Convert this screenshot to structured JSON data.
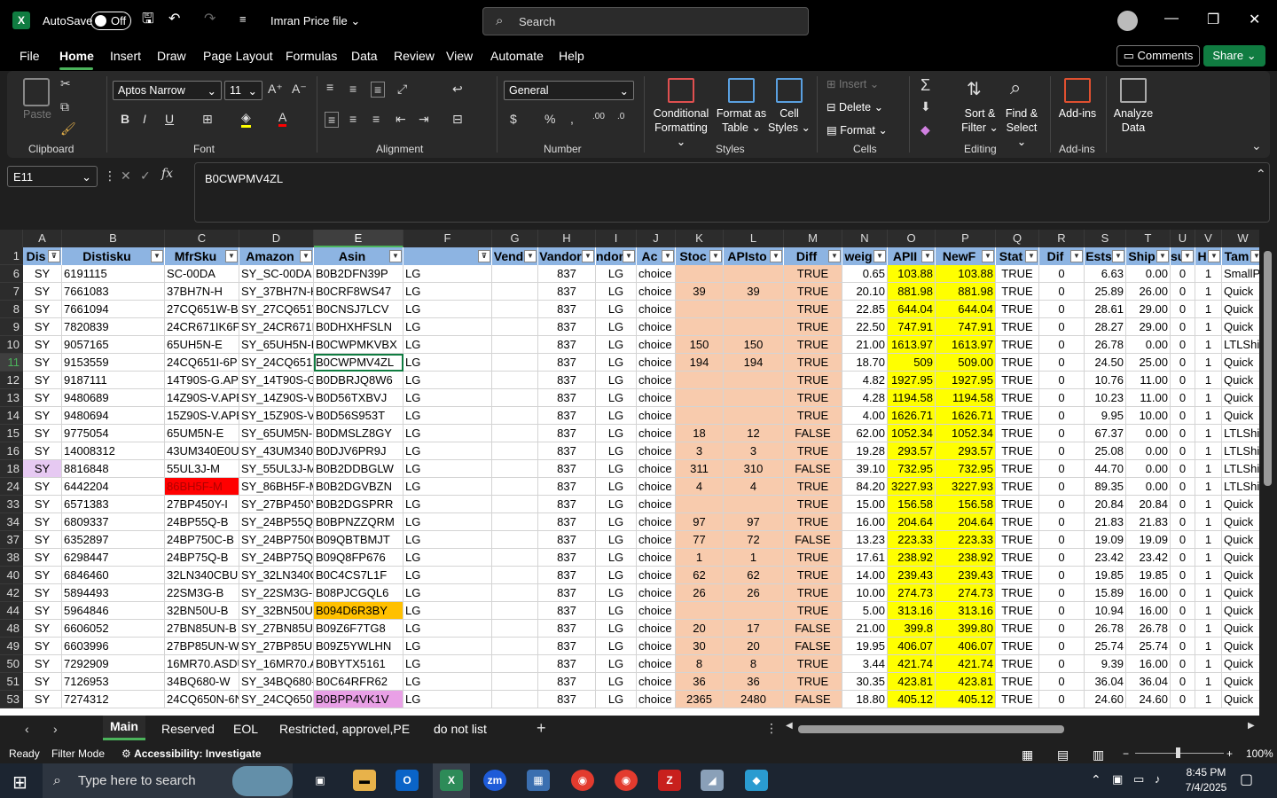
{
  "titlebar": {
    "autosave": "AutoSave",
    "toggle": "Off",
    "filename": "Imran Price file",
    "search_placeholder": "Search"
  },
  "menu": {
    "items": [
      "File",
      "Home",
      "Insert",
      "Draw",
      "Page Layout",
      "Formulas",
      "Data",
      "Review",
      "View",
      "Automate",
      "Help"
    ],
    "comments": "Comments",
    "share": "Share"
  },
  "ribbon": {
    "clipboard": {
      "paste": "Paste",
      "label": "Clipboard"
    },
    "font": {
      "name": "Aptos Narrow",
      "size": "11",
      "label": "Font"
    },
    "alignment": {
      "label": "Alignment"
    },
    "number": {
      "format": "General",
      "label": "Number"
    },
    "styles": {
      "conditional": "Conditional",
      "formatting": "Formatting",
      "format_as": "Format as",
      "table": "Table",
      "cell": "Cell",
      "styles_btn": "Styles",
      "label": "Styles"
    },
    "cells": {
      "insert": "Insert",
      "delete": "Delete",
      "format": "Format",
      "label": "Cells"
    },
    "editing": {
      "sort": "Sort &",
      "filter": "Filter",
      "find": "Find &",
      "select": "Select",
      "label": "Editing"
    },
    "addins": {
      "addins": "Add-ins",
      "label": "Add-ins",
      "analyze": "Analyze",
      "data": "Data"
    }
  },
  "formula": {
    "namebox": "E11",
    "value": "B0CWPMV4ZL"
  },
  "columns": [
    "A",
    "B",
    "C",
    "D",
    "E",
    "F",
    "G",
    "H",
    "I",
    "J",
    "K",
    "L",
    "M",
    "N",
    "O",
    "P",
    "Q",
    "R",
    "S",
    "T",
    "U",
    "V",
    "W"
  ],
  "headers": [
    "Dis",
    "Distisku",
    "MfrSku",
    "Amazon",
    "Asin",
    "",
    "Vend",
    "Vandor",
    "ndor",
    "Ac",
    "Stoc",
    "APIsto",
    "Diff",
    "weig",
    "APII",
    "NewF",
    "Stat",
    "Dif",
    "Ests",
    "Ship",
    "su",
    "H",
    "Tam"
  ],
  "rows": [
    {
      "n": "6",
      "v": [
        "SY",
        "6191115",
        "SC-00DA",
        "SY_SC-00DA",
        "B0B2DFN39P",
        "LG",
        "",
        "837",
        "LG",
        "choice",
        "",
        "",
        "TRUE",
        "0.65",
        "103.88",
        "103.88",
        "TRUE",
        "0",
        "6.63",
        "0.00",
        "0",
        "1",
        "SmallP"
      ]
    },
    {
      "n": "7",
      "v": [
        "SY",
        "7661083",
        "37BH7N-H",
        "SY_37BH7N-H",
        "B0CRF8WS47",
        "LG",
        "",
        "837",
        "LG",
        "choice",
        "39",
        "39",
        "TRUE",
        "20.10",
        "881.98",
        "881.98",
        "TRUE",
        "0",
        "25.89",
        "26.00",
        "0",
        "1",
        "Quick"
      ]
    },
    {
      "n": "8",
      "v": [
        "SY",
        "7661094",
        "27CQ651W-B",
        "SY_27CQ651W",
        "B0CNSJ7LCV",
        "LG",
        "",
        "837",
        "LG",
        "choice",
        "",
        "",
        "TRUE",
        "22.85",
        "644.04",
        "644.04",
        "TRUE",
        "0",
        "28.61",
        "29.00",
        "0",
        "1",
        "Quick"
      ]
    },
    {
      "n": "9",
      "v": [
        "SY",
        "7820839",
        "24CR671IK6P",
        "SY_24CR671IK",
        "B0DHXHFSLN",
        "LG",
        "",
        "837",
        "LG",
        "choice",
        "",
        "",
        "TRUE",
        "22.50",
        "747.91",
        "747.91",
        "TRUE",
        "0",
        "28.27",
        "29.00",
        "0",
        "1",
        "Quick"
      ]
    },
    {
      "n": "10",
      "v": [
        "SY",
        "9057165",
        "65UH5N-E",
        "SY_65UH5N-E",
        "B0CWPMKVBX",
        "LG",
        "",
        "837",
        "LG",
        "choice",
        "150",
        "150",
        "TRUE",
        "21.00",
        "1613.97",
        "1613.97",
        "TRUE",
        "0",
        "26.78",
        "0.00",
        "0",
        "1",
        "LTLShi"
      ]
    },
    {
      "n": "11",
      "v": [
        "SY",
        "9153559",
        "24CQ651I-6P",
        "SY_24CQ651I-",
        "B0CWPMV4ZL",
        "LG",
        "",
        "837",
        "LG",
        "choice",
        "194",
        "194",
        "TRUE",
        "18.70",
        "509",
        "509.00",
        "TRUE",
        "0",
        "24.50",
        "25.00",
        "0",
        "1",
        "Quick"
      ]
    },
    {
      "n": "12",
      "v": [
        "SY",
        "9187111",
        "14T90S-G.AP",
        "SY_14T90S-G.",
        "B0DBRJQ8W6",
        "LG",
        "",
        "837",
        "LG",
        "choice",
        "",
        "",
        "TRUE",
        "4.82",
        "1927.95",
        "1927.95",
        "TRUE",
        "0",
        "10.76",
        "11.00",
        "0",
        "1",
        "Quick"
      ]
    },
    {
      "n": "13",
      "v": [
        "SY",
        "9480689",
        "14Z90S-V.APE",
        "SY_14Z90S-V.",
        "B0D56TXBVJ",
        "LG",
        "",
        "837",
        "LG",
        "choice",
        "",
        "",
        "TRUE",
        "4.28",
        "1194.58",
        "1194.58",
        "TRUE",
        "0",
        "10.23",
        "11.00",
        "0",
        "1",
        "Quick"
      ]
    },
    {
      "n": "14",
      "v": [
        "SY",
        "9480694",
        "15Z90S-V.APE",
        "SY_15Z90S-V.",
        "B0D56S953T",
        "LG",
        "",
        "837",
        "LG",
        "choice",
        "",
        "",
        "TRUE",
        "4.00",
        "1626.71",
        "1626.71",
        "TRUE",
        "0",
        "9.95",
        "10.00",
        "0",
        "1",
        "Quick"
      ]
    },
    {
      "n": "15",
      "v": [
        "SY",
        "9775054",
        "65UM5N-E",
        "SY_65UM5N-E",
        "B0DMSLZ8GY",
        "LG",
        "",
        "837",
        "LG",
        "choice",
        "18",
        "12",
        "FALSE",
        "62.00",
        "1052.34",
        "1052.34",
        "TRUE",
        "0",
        "67.37",
        "0.00",
        "0",
        "1",
        "LTLShi"
      ]
    },
    {
      "n": "16",
      "v": [
        "SY",
        "14008312",
        "43UM340E0U",
        "SY_43UM340E",
        "B0DJV6PR9J",
        "LG",
        "",
        "837",
        "LG",
        "choice",
        "3",
        "3",
        "TRUE",
        "19.28",
        "293.57",
        "293.57",
        "TRUE",
        "0",
        "25.08",
        "0.00",
        "0",
        "1",
        "LTLShi"
      ]
    },
    {
      "n": "18",
      "v": [
        "SY",
        "8816848",
        "55UL3J-M",
        "SY_55UL3J-M",
        "B0B2DDBGLW",
        "LG",
        "",
        "837",
        "LG",
        "choice",
        "311",
        "310",
        "FALSE",
        "39.10",
        "732.95",
        "732.95",
        "TRUE",
        "0",
        "44.70",
        "0.00",
        "0",
        "1",
        "LTLShi"
      ]
    },
    {
      "n": "24",
      "v": [
        "SY",
        "6442204",
        "86BH5F-M",
        "SY_86BH5F-M",
        "B0B2DGVBZN",
        "LG",
        "",
        "837",
        "LG",
        "choice",
        "4",
        "4",
        "TRUE",
        "84.20",
        "3227.93",
        "3227.93",
        "TRUE",
        "0",
        "89.35",
        "0.00",
        "0",
        "1",
        "LTLShi"
      ]
    },
    {
      "n": "33",
      "v": [
        "SY",
        "6571383",
        "27BP450Y-I",
        "SY_27BP450Y-",
        "B0B2DGSPRR",
        "LG",
        "",
        "837",
        "LG",
        "choice",
        "",
        "",
        "TRUE",
        "15.00",
        "156.58",
        "156.58",
        "TRUE",
        "0",
        "20.84",
        "20.84",
        "0",
        "1",
        "Quick"
      ]
    },
    {
      "n": "34",
      "v": [
        "SY",
        "6809337",
        "24BP55Q-B",
        "SY_24BP55Q-I",
        "B0BPNZZQRM",
        "LG",
        "",
        "837",
        "LG",
        "choice",
        "97",
        "97",
        "TRUE",
        "16.00",
        "204.64",
        "204.64",
        "TRUE",
        "0",
        "21.83",
        "21.83",
        "0",
        "1",
        "Quick"
      ]
    },
    {
      "n": "37",
      "v": [
        "SY",
        "6352897",
        "24BP750C-B",
        "SY_24BP750C-",
        "B09QBTBMJT",
        "LG",
        "",
        "837",
        "LG",
        "choice",
        "77",
        "72",
        "FALSE",
        "13.23",
        "223.33",
        "223.33",
        "TRUE",
        "0",
        "19.09",
        "19.09",
        "0",
        "1",
        "Quick"
      ]
    },
    {
      "n": "38",
      "v": [
        "SY",
        "6298447",
        "24BP75Q-B",
        "SY_24BP75Q-I",
        "B09Q8FP676",
        "LG",
        "",
        "837",
        "LG",
        "choice",
        "1",
        "1",
        "TRUE",
        "17.61",
        "238.92",
        "238.92",
        "TRUE",
        "0",
        "23.42",
        "23.42",
        "0",
        "1",
        "Quick"
      ]
    },
    {
      "n": "40",
      "v": [
        "SY",
        "6846460",
        "32LN340CBU",
        "SY_32LN340C",
        "B0C4CS7L1F",
        "LG",
        "",
        "837",
        "LG",
        "choice",
        "62",
        "62",
        "TRUE",
        "14.00",
        "239.43",
        "239.43",
        "TRUE",
        "0",
        "19.85",
        "19.85",
        "0",
        "1",
        "Quick"
      ]
    },
    {
      "n": "42",
      "v": [
        "SY",
        "5894493",
        "22SM3G-B",
        "SY_22SM3G-B",
        "B08PJCGQL6",
        "LG",
        "",
        "837",
        "LG",
        "choice",
        "26",
        "26",
        "TRUE",
        "10.00",
        "274.73",
        "274.73",
        "TRUE",
        "0",
        "15.89",
        "16.00",
        "0",
        "1",
        "Quick"
      ]
    },
    {
      "n": "44",
      "v": [
        "SY",
        "5964846",
        "32BN50U-B",
        "SY_32BN50U-",
        "B094D6R3BY",
        "LG",
        "",
        "837",
        "LG",
        "choice",
        "",
        "",
        "TRUE",
        "5.00",
        "313.16",
        "313.16",
        "TRUE",
        "0",
        "10.94",
        "16.00",
        "0",
        "1",
        "Quick"
      ]
    },
    {
      "n": "48",
      "v": [
        "SY",
        "6606052",
        "27BN85UN-B",
        "SY_27BN85UN",
        "B09Z6F7TG8",
        "LG",
        "",
        "837",
        "LG",
        "choice",
        "20",
        "17",
        "FALSE",
        "21.00",
        "399.8",
        "399.80",
        "TRUE",
        "0",
        "26.78",
        "26.78",
        "0",
        "1",
        "Quick"
      ]
    },
    {
      "n": "49",
      "v": [
        "SY",
        "6603996",
        "27BP85UN-W",
        "SY_27BP85UN",
        "B09Z5YWLHN",
        "LG",
        "",
        "837",
        "LG",
        "choice",
        "30",
        "20",
        "FALSE",
        "19.95",
        "406.07",
        "406.07",
        "TRUE",
        "0",
        "25.74",
        "25.74",
        "0",
        "1",
        "Quick"
      ]
    },
    {
      "n": "50",
      "v": [
        "SY",
        "7292909",
        "16MR70.ASDU",
        "SY_16MR70.A",
        "B0BYTX5161",
        "LG",
        "",
        "837",
        "LG",
        "choice",
        "8",
        "8",
        "TRUE",
        "3.44",
        "421.74",
        "421.74",
        "TRUE",
        "0",
        "9.39",
        "16.00",
        "0",
        "1",
        "Quick"
      ]
    },
    {
      "n": "51",
      "v": [
        "SY",
        "7126953",
        "34BQ680-W",
        "SY_34BQ680-V",
        "B0C64RFR62",
        "LG",
        "",
        "837",
        "LG",
        "choice",
        "36",
        "36",
        "TRUE",
        "30.35",
        "423.81",
        "423.81",
        "TRUE",
        "0",
        "36.04",
        "36.04",
        "0",
        "1",
        "Quick"
      ]
    },
    {
      "n": "53",
      "v": [
        "SY",
        "7274312",
        "24CQ650N-6N",
        "SY_24CQ650N",
        "B0BPP4VK1V",
        "LG",
        "",
        "837",
        "LG",
        "choice",
        "2365",
        "2480",
        "FALSE",
        "18.80",
        "405.12",
        "405.12",
        "TRUE",
        "0",
        "24.60",
        "24.60",
        "0",
        "1",
        "Quick"
      ]
    }
  ],
  "sheets": [
    "Main",
    "Reserved",
    "EOL",
    "Restricted, approvel,PE",
    "do not list"
  ],
  "status": {
    "ready": "Ready",
    "filter": "Filter Mode",
    "accessibility": "Accessibility: Investigate",
    "zoom": "100%"
  },
  "taskbar": {
    "search": "Type here to search",
    "time": "8:45 PM",
    "date": "7/4/2025"
  },
  "colors": {
    "header_blue": "#8db4e2",
    "salmon": "#f8cbad",
    "yellow": "#ffff00",
    "red": "#ff0000",
    "orange": "#ffc000",
    "pink": "#e9a0e6",
    "lilac": "#e6c9f2",
    "accent": "#107c41"
  }
}
